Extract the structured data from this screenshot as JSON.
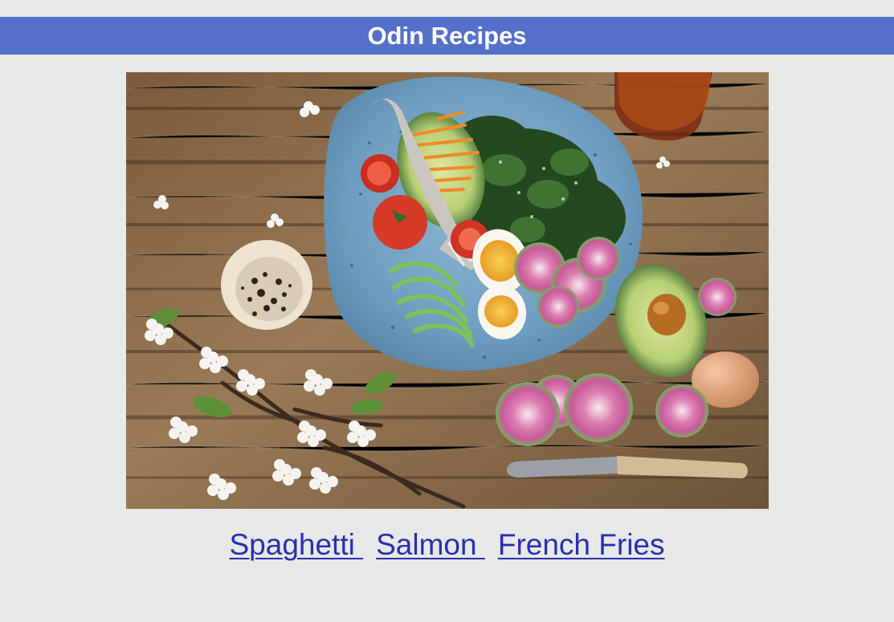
{
  "header": {
    "title": "Odin Recipes"
  },
  "hero": {
    "icon": "salad-bowl-photo",
    "colors": {
      "wood_dark": "#6c5135",
      "wood_mid": "#8b6a46",
      "bowl": "#6e9ec1",
      "egg_yolk": "#f2b33d",
      "tomato": "#d63a28",
      "avocado": "#b7cf73",
      "radish": "#c95a9c"
    }
  },
  "links": [
    {
      "label": "Spaghetti "
    },
    {
      "label": "Salmon "
    },
    {
      "label": "French Fries"
    }
  ]
}
